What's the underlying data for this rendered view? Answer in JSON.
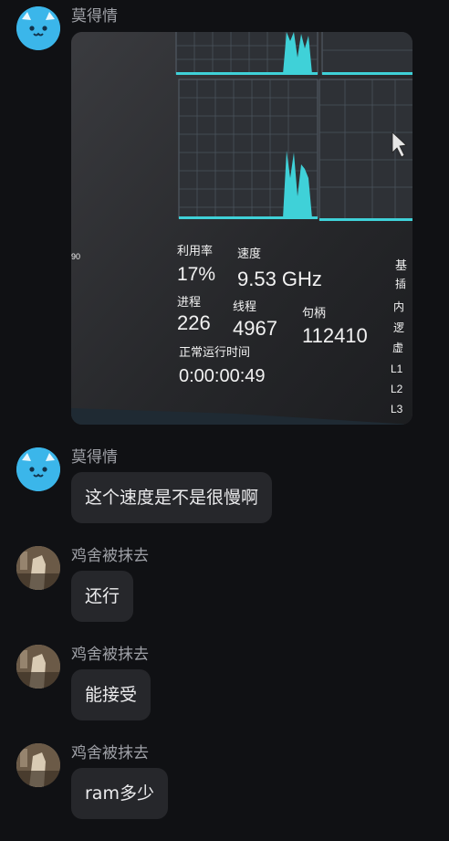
{
  "messages": [
    {
      "sender": "莫得情",
      "type": "image",
      "image": {
        "utilization_label": "利用率",
        "utilization": "17%",
        "speed_label": "速度",
        "speed": "9.53 GHz",
        "processes_label": "进程",
        "processes": "226",
        "threads_label": "线程",
        "threads": "4967",
        "handles_label": "句柄",
        "handles": "112410",
        "uptime_label": "正常运行时间",
        "uptime": "0:00:00:49",
        "right_labels": [
          "基",
          "插",
          "内",
          "逻",
          "虚",
          "L1",
          "L2",
          "L3"
        ],
        "left_edge_text": "90"
      }
    },
    {
      "sender": "莫得情",
      "type": "text",
      "text": "这个速度是不是很慢啊"
    },
    {
      "sender": "鸡舍被抹去",
      "type": "text",
      "text": "还行"
    },
    {
      "sender": "鸡舍被抹去",
      "type": "text",
      "text": "能接受"
    },
    {
      "sender": "鸡舍被抹去",
      "type": "text",
      "text": "ram多少"
    }
  ],
  "colors": {
    "background": "#101114",
    "bubble": "#26272b",
    "name": "#9ea0a6",
    "graph": "#3fd1d8",
    "avatar_blue": "#3bb6ea"
  }
}
